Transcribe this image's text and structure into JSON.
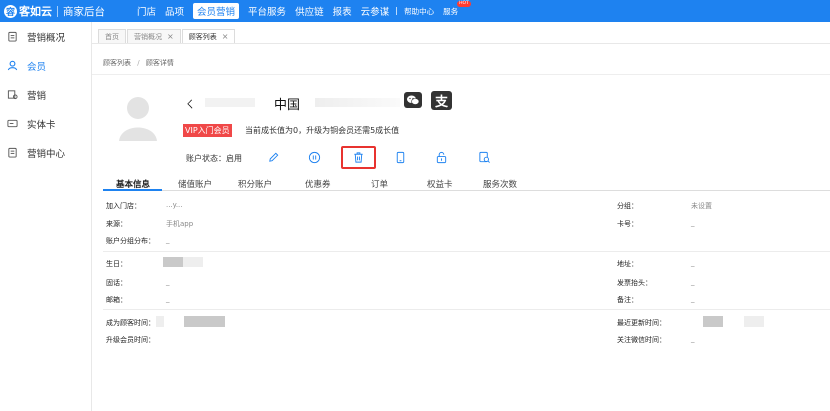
{
  "brand": {
    "logo_glyph": "容",
    "name": "客如云",
    "sub": "商家后台"
  },
  "topnav": {
    "items": [
      "门店",
      "品项",
      "会员营销",
      "平台服务",
      "供应链",
      "报表",
      "云参谋"
    ],
    "active": "会员营销",
    "help": "帮助中心",
    "service": "服务",
    "hot_badge": "HOT"
  },
  "sidebar": {
    "items": [
      {
        "label": "营销概况",
        "icon": "clipboard-icon"
      },
      {
        "label": "会员",
        "icon": "members-icon",
        "active": true
      },
      {
        "label": "营销",
        "icon": "marketing-icon"
      },
      {
        "label": "实体卡",
        "icon": "card-icon"
      },
      {
        "label": "营销中心",
        "icon": "center-icon"
      }
    ]
  },
  "page_tabs": [
    {
      "label": "首页",
      "closable": false
    },
    {
      "label": "营销概况",
      "closable": true
    },
    {
      "label": "顾客列表",
      "closable": true,
      "active": true
    }
  ],
  "close_glyph": "×",
  "breadcrumb": {
    "parent": "顾客列表",
    "separator": "/",
    "current": "顾客详情"
  },
  "profile": {
    "name_masked": "ㄑ",
    "country": "中国",
    "alipay_glyph": "支",
    "vip_level": "VIP入门会员",
    "growth_text": "当前成长值为0，升级为铜会员还需5成长值",
    "status_label": "账户状态：",
    "status_value": "启用",
    "action_icons": [
      "edit-icon",
      "pause-icon",
      "delete-icon",
      "phone-icon",
      "unlock-icon",
      "member-search-icon"
    ]
  },
  "detail_tabs": [
    "基本信息",
    "储值账户",
    "积分账户",
    "优惠券",
    "订单",
    "权益卡",
    "服务次数"
  ],
  "fields": {
    "store_label": "加入门店：",
    "store_value": "...y...",
    "source_label": "来源：",
    "source_value": "手机app",
    "dist_label": "账户分组分布：",
    "dist_value": "_",
    "group_label": "分组：",
    "group_value": "未设置",
    "card_label": "卡号：",
    "card_value": "_",
    "birthday_label": "生日：",
    "landline_label": "固话：",
    "landline_value": "_",
    "email_label": "邮箱：",
    "email_value": "_",
    "address_label": "地址：",
    "address_value": "_",
    "invoice_label": "发票抬头：",
    "invoice_value": "_",
    "remark_label": "备注：",
    "remark_value": "_",
    "customer_since_label": "成为顾客时间：",
    "upgrade_label": "升级会员时间：",
    "last_update_label": "最近更新时间：",
    "wechat_follow_label": "关注微信时间：",
    "wechat_follow_value": "_"
  },
  "colors": {
    "primary": "#1e82f0",
    "danger": "#e8332f",
    "vip": "#f04848"
  }
}
